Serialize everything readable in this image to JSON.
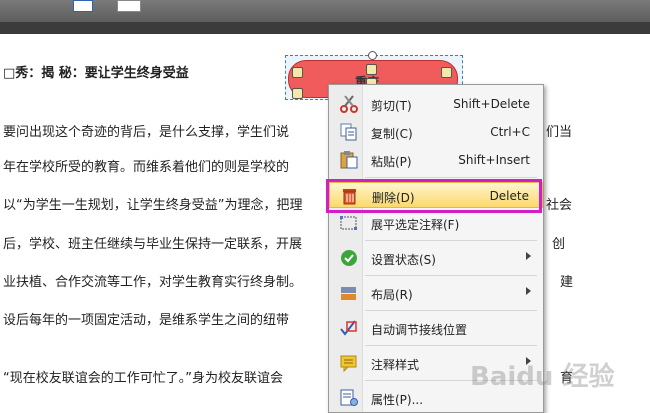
{
  "document": {
    "lines": [
      "□秀：揭 秘：要让学生终身受益",
      "要问出现这个奇迹的背后，是什么支撑，学生们说",
      "年在学校所受的教育。而维系着他们的则是学校的",
      "以“为学生一生规划，让学生终身受益”为理念，把理",
      "后，学校、班主任继续与毕业生保持一定联系，开展",
      "业扶植、合作交流等工作，对学生教育实行终身制。",
      "设后每年的一项固定活动，是维系学生之间的纽带",
      "“现在校友联谊会的工作可忙了。”身为校友联谊会"
    ],
    "right_fragments": [
      "们当",
      "社会",
      "创",
      "建",
      "育"
    ],
    "annotation_text": "重庆"
  },
  "menu": {
    "items": [
      {
        "label": "剪切(T)",
        "shortcut": "Shift+Delete",
        "icon": "scissors-icon"
      },
      {
        "label": "复制(C)",
        "shortcut": "Ctrl+C",
        "icon": "copy-icon"
      },
      {
        "label": "粘贴(P)",
        "shortcut": "Shift+Insert",
        "icon": "paste-icon"
      },
      {
        "label": "删除(D)",
        "shortcut": "Delete",
        "icon": "trash-icon"
      },
      {
        "label": "展平选定注释(F)",
        "shortcut": "",
        "icon": "flatten-icon"
      },
      {
        "label": "设置状态(S)",
        "shortcut": "",
        "icon": "check-icon"
      },
      {
        "label": "布局(R)",
        "shortcut": "",
        "icon": "layout-icon"
      },
      {
        "label": "自动调节接线位置",
        "shortcut": "",
        "icon": "connector-icon"
      },
      {
        "label": "注释样式",
        "shortcut": "",
        "icon": "comment-style-icon"
      },
      {
        "label": "属性(P)...",
        "shortcut": "",
        "icon": "properties-icon"
      }
    ]
  },
  "colors": {
    "highlight_frame": "#d21ec8",
    "annotation_fill": "#f05b5b",
    "menu_bg": "#f5f5f5"
  },
  "watermark": "Baidu 经验"
}
